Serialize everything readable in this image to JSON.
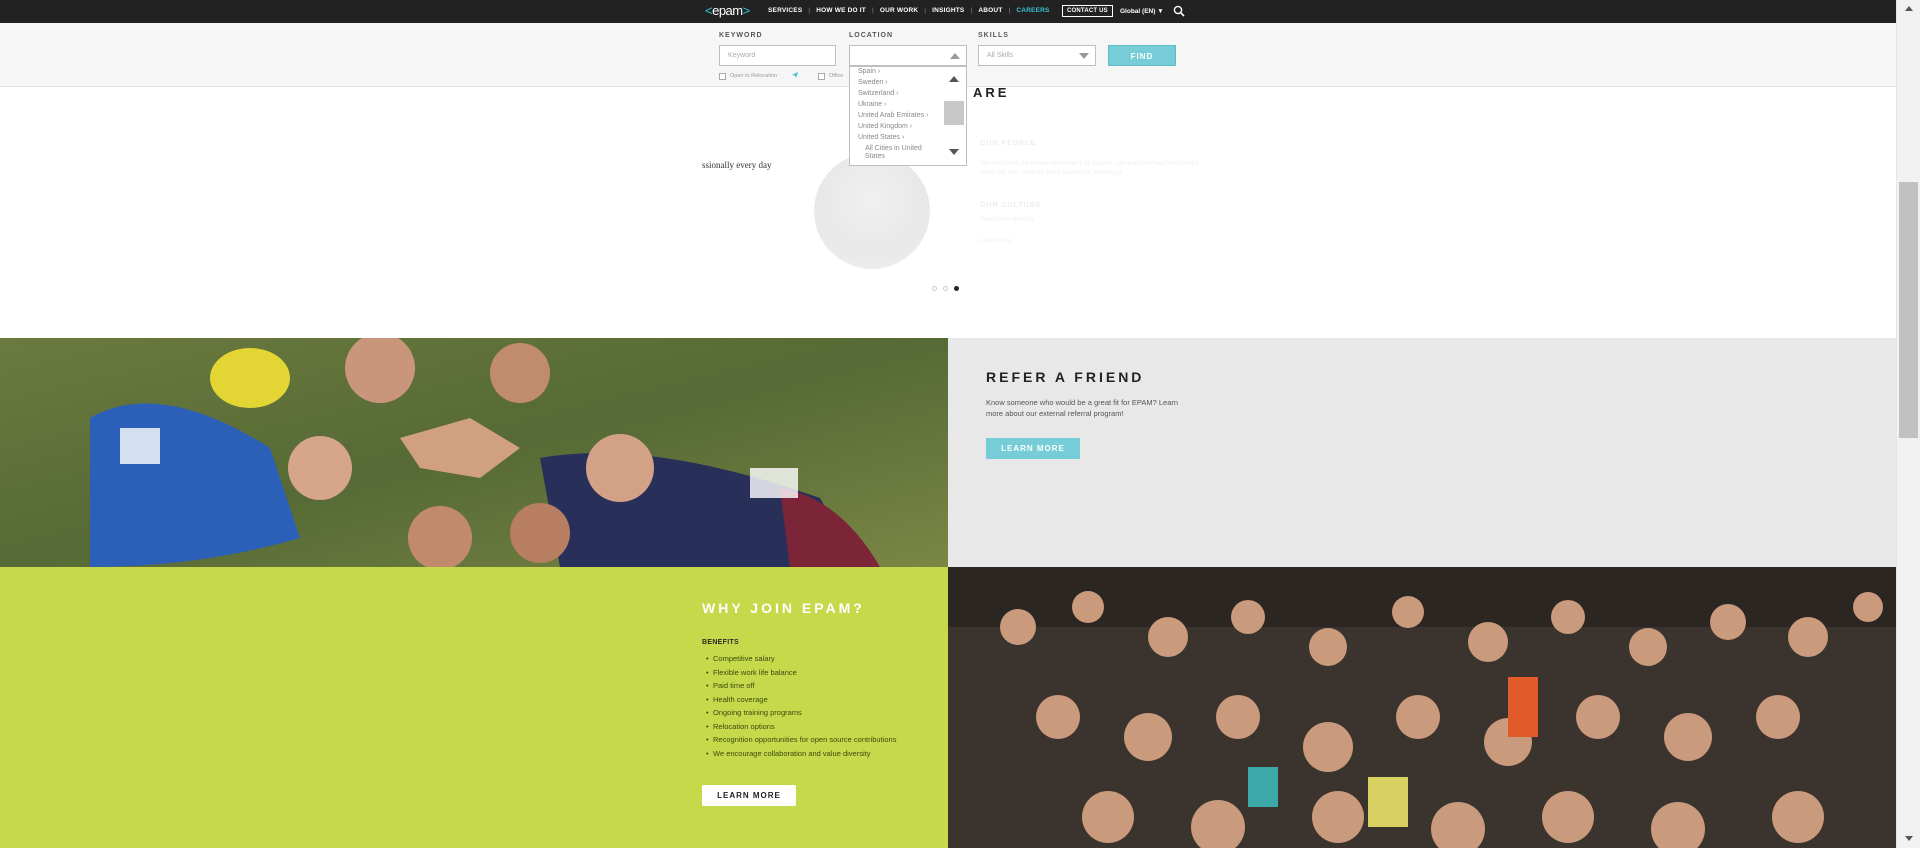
{
  "nav": {
    "logo": "epam",
    "links": [
      "SERVICES",
      "HOW WE DO IT",
      "OUR WORK",
      "INSIGHTS",
      "ABOUT",
      "CAREERS"
    ],
    "active_link": "CAREERS",
    "contact": "CONTACT US",
    "global": "Global (EN) ▼",
    "accent_color": "#39c2d7"
  },
  "search": {
    "keyword_label": "KEYWORD",
    "keyword_placeholder": "Keyword",
    "location_label": "LOCATION",
    "location_value": "",
    "skills_label": "SKILLS",
    "skills_value": "All Skills",
    "find_label": "FIND",
    "relocation_label": "Open to Relocation",
    "office_label": "Office",
    "location_options": [
      "Spain",
      "Sweden",
      "Switzerland",
      "Ukraine",
      "United Arab Emirates",
      "United Kingdom",
      "United States",
      "All Cities in United",
      "States"
    ]
  },
  "carousel": {
    "title_fragment": "ARE",
    "quote_fragment": "ssionally every day",
    "faded_heading_1": "OUR PEOPLE",
    "faded_text_1": "We are EPAM: the people who make it all happen, who push and lead the industry every day with creativity and a passion for technology.",
    "faded_heading_2": "OUR CULTURE",
    "faded_text_2": "Read more about us",
    "faded_link": "Learn more",
    "active_dot": 3
  },
  "refer": {
    "title": "REFER A FRIEND",
    "description": "Know someone who would be a great fit for EPAM? Learn more about our external referral program!",
    "button": "LEARN MORE",
    "button_color": "#76cdd8"
  },
  "why": {
    "title": "WHY JOIN EPAM?",
    "benefits_label": "BENEFITS",
    "benefits": [
      "Competitive salary",
      "Flexible work life balance",
      "Paid time off",
      "Health coverage",
      "Ongoing training programs",
      "Relocation options",
      "Recognition opportunities for open source contributions",
      "We encourage collaboration and value diversity"
    ],
    "button": "LEARN MORE",
    "panel_color": "#c5d94a"
  }
}
